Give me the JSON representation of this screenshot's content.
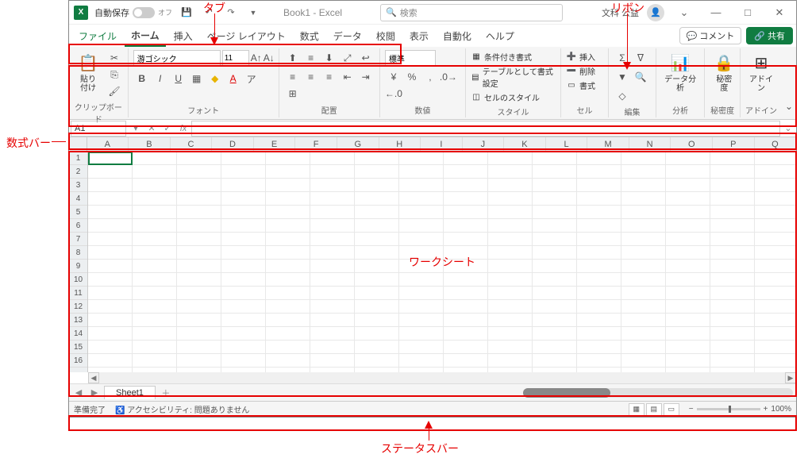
{
  "annotations": {
    "tab": "タブ",
    "ribbon": "リボン",
    "formula_bar": "数式バー",
    "worksheet": "ワークシート",
    "status_bar": "ステータスバー"
  },
  "titlebar": {
    "autosave_label": "自動保存",
    "autosave_state": "オフ",
    "title": "Book1 - Excel",
    "search_placeholder": "検索",
    "user_name": "文科 公益",
    "minimize": "—",
    "maximize": "□",
    "close": "✕"
  },
  "tabs": {
    "file": "ファイル",
    "home": "ホーム",
    "insert": "挿入",
    "page_layout": "ページ レイアウト",
    "formulas": "数式",
    "data": "データ",
    "review": "校閲",
    "view": "表示",
    "automate": "自動化",
    "help": "ヘルプ",
    "comments": "コメント",
    "share": "共有"
  },
  "ribbon": {
    "clipboard": {
      "paste": "貼り付け",
      "label": "クリップボード"
    },
    "font": {
      "name": "游ゴシック",
      "size": "11",
      "label": "フォント"
    },
    "alignment": {
      "label": "配置"
    },
    "number": {
      "format": "標準",
      "label": "数値"
    },
    "styles": {
      "conditional": "条件付き書式",
      "table": "テーブルとして書式設定",
      "cell_styles": "セルのスタイル",
      "label": "スタイル"
    },
    "cells": {
      "insert": "挿入",
      "delete": "削除",
      "format": "書式",
      "label": "セル"
    },
    "editing": {
      "label": "編集"
    },
    "analysis": {
      "data_analysis": "データ分析",
      "label": "分析"
    },
    "sensitivity": {
      "btn": "秘密度",
      "label": "秘密度"
    },
    "addins": {
      "btn": "アドイン",
      "label": "アドイン"
    }
  },
  "formula_bar": {
    "cell_ref": "A1"
  },
  "columns": [
    "A",
    "B",
    "C",
    "D",
    "E",
    "F",
    "G",
    "H",
    "I",
    "J",
    "K",
    "L",
    "M",
    "N",
    "O",
    "P",
    "Q"
  ],
  "rows": [
    "1",
    "2",
    "3",
    "4",
    "5",
    "6",
    "7",
    "8",
    "9",
    "10",
    "11",
    "12",
    "13",
    "14",
    "15",
    "16"
  ],
  "sheet_tabs": {
    "sheet1": "Sheet1"
  },
  "status": {
    "ready": "準備完了",
    "accessibility": "アクセシビリティ: 問題ありません",
    "zoom": "100%"
  }
}
